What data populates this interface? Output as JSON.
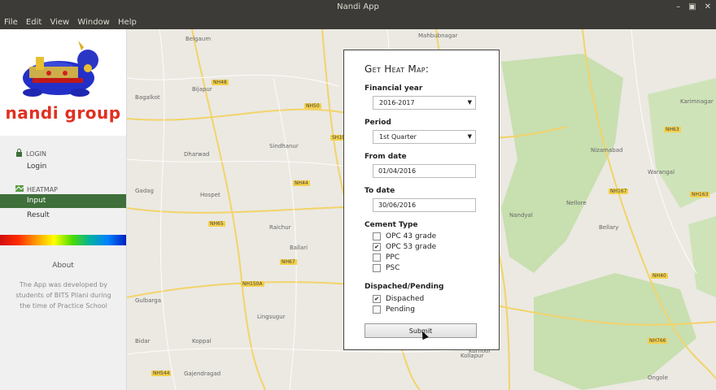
{
  "window": {
    "title": "Nandi App",
    "controls": [
      "–",
      "▣",
      "✕"
    ]
  },
  "menu": {
    "items": [
      "File",
      "Edit",
      "View",
      "Window",
      "Help"
    ]
  },
  "sidebar": {
    "brand_text": "nandi group",
    "login_section": "LOGIN",
    "login_item": "Login",
    "heatmap_section": "HEATMAP",
    "heatmap_items": [
      "Input",
      "Result"
    ],
    "about_title": "About",
    "about_text": "The App was developed by students of BITS Pilani during the time of Practice School"
  },
  "map": {
    "towns": [
      "Belgaum",
      "Bagalkot",
      "Bijapur",
      "Gadag",
      "Raichur",
      "Ballari",
      "Sindhanur",
      "Mahbubnagar",
      "Kurnool",
      "Gulbarga",
      "Bidar",
      "Nizamabad",
      "Warangal",
      "Ongole",
      "Nellore",
      "Nandyal",
      "Bellary",
      "Karimnagar",
      "Kollapur",
      "Dharwad",
      "Hospet",
      "Koppal",
      "Lingsugur",
      "Gajendragad"
    ],
    "roads": [
      "NH48",
      "NH50",
      "NH44",
      "NH65",
      "NH67",
      "NH150A",
      "NH63",
      "NH163",
      "NH167",
      "NH40",
      "SH19",
      "NH544",
      "NH766"
    ]
  },
  "form": {
    "title": "Get Heat Map:",
    "financial_year_label": "Financial year",
    "financial_year_value": "2016-2017",
    "period_label": "Period",
    "period_value": "1st Quarter",
    "from_date_label": "From date",
    "from_date_value": "01/04/2016",
    "to_date_label": "To date",
    "to_date_value": "30/06/2016",
    "cement_type_label": "Cement Type",
    "cement_types": [
      {
        "label": "OPC 43 grade",
        "checked": false
      },
      {
        "label": "OPC 53 grade",
        "checked": true
      },
      {
        "label": "PPC",
        "checked": false
      },
      {
        "label": "PSC",
        "checked": false
      }
    ],
    "dispatch_label": "Dispached/Pending",
    "dispatch_options": [
      {
        "label": "Dispached",
        "checked": true
      },
      {
        "label": "Pending",
        "checked": false
      }
    ],
    "submit_label": "Submit",
    "check_mark": "✔"
  },
  "colors": {
    "active_nav": "#3f6f3a",
    "titlebar": "#3c3b37",
    "map_green": "#c8dfb0"
  }
}
